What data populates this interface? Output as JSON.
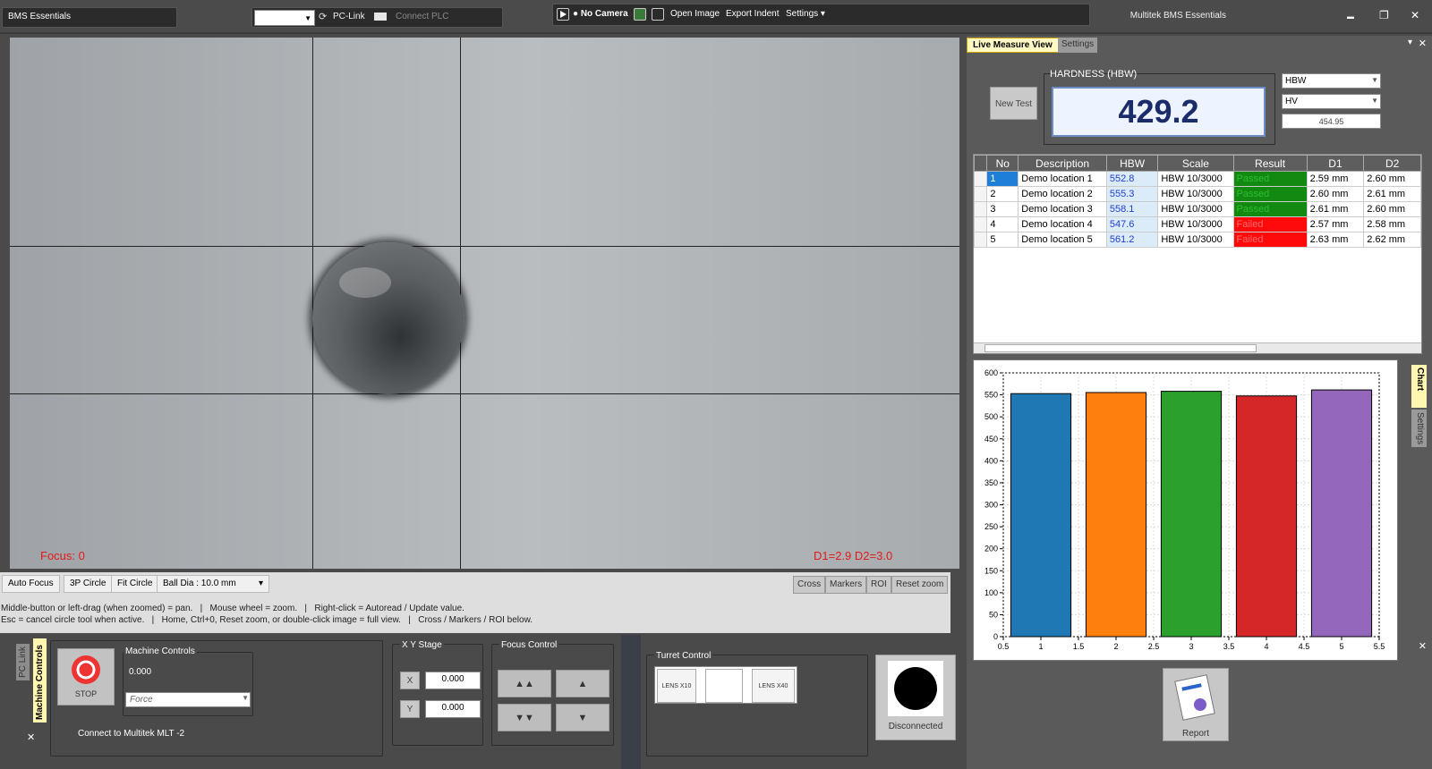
{
  "app": {
    "name": "BMS Essentials",
    "window_title": "Multitek BMS Essentials"
  },
  "plc": {
    "refresh_icon": "refresh-icon",
    "pclink_label": "PC-Link",
    "connect_label": "Connect PLC"
  },
  "toolbar": {
    "camera_status": "No Camera",
    "open_image": "Open Image",
    "export_indent": "Export Indent",
    "settings": "Settings"
  },
  "window_controls": {
    "minimize": "▬",
    "maximize": "❐",
    "close": "✕"
  },
  "camera": {
    "focus_label": "Focus: 0",
    "diameter_label": "D1=2.9 D2=3.0"
  },
  "tools": {
    "auto_focus": "Auto Focus",
    "circle_3p": "3P Circle",
    "fit_circle": "Fit Circle",
    "ball_dia": "Ball Dia : 10.0 mm",
    "cross": "Cross",
    "markers": "Markers",
    "roi": "ROI",
    "reset_zoom": "Reset zoom",
    "hint1": "Middle-button or left-drag (when zoomed) = pan.   |   Mouse wheel = zoom.   |   Right-click = Autoread / Update value.",
    "hint2": "Esc = cancel circle tool when active.   |   Home, Ctrl+0, Reset zoom, or double-click image = full view.   |   Cross / Markers / ROI below."
  },
  "machine": {
    "tab_pclink": "PC Link",
    "tab_machine": "Machine Controls",
    "stop_label": "STOP",
    "group_label": "Machine Controls",
    "value": "0.000",
    "force_placeholder": "Force",
    "connect_text": "Connect to Multitek MLT -2"
  },
  "xy_stage": {
    "label": "X Y Stage",
    "x_label": "X",
    "y_label": "Y",
    "x_value": "0.000",
    "y_value": "0.000"
  },
  "focus_control": {
    "label": "Focus Control",
    "up_fast": "▲▲",
    "up": "▲",
    "down_fast": "▼▼",
    "down": "▼"
  },
  "turret": {
    "label": "Turret Control",
    "lens1": "LENS X10",
    "lens2": "LENS X40"
  },
  "connection": {
    "status": "Disconnected"
  },
  "right_panel": {
    "tab_live": "Live Measure View",
    "tab_settings": "Settings",
    "hardness_label": "HARDNESS  (HBW)",
    "hardness_value": "429.2",
    "new_test": "New Test",
    "scale1": "HBW",
    "scale2": "HV",
    "converted_value": "454.95",
    "report": "Report",
    "chart_tab": "Chart",
    "chart_settings_tab": "Settings"
  },
  "table": {
    "headers": [
      "No",
      "Description",
      "HBW",
      "Scale",
      "Result",
      "D1",
      "D2"
    ],
    "rows": [
      [
        "1",
        "Demo location 1",
        "552.8",
        "HBW 10/3000",
        "Passed",
        "2.59 mm",
        "2.60 mm"
      ],
      [
        "2",
        "Demo location 2",
        "555.3",
        "HBW 10/3000",
        "Passed",
        "2.60 mm",
        "2.61 mm"
      ],
      [
        "3",
        "Demo location 3",
        "558.1",
        "HBW 10/3000",
        "Passed",
        "2.61 mm",
        "2.60 mm"
      ],
      [
        "4",
        "Demo location 4",
        "547.6",
        "HBW 10/3000",
        "Failed",
        "2.57 mm",
        "2.58 mm"
      ],
      [
        "5",
        "Demo location 5",
        "561.2",
        "HBW 10/3000",
        "Failed",
        "2.63 mm",
        "2.62 mm"
      ]
    ]
  },
  "chart_data": {
    "type": "bar",
    "x": [
      1,
      2,
      3,
      4,
      5
    ],
    "values": [
      552.8,
      555.3,
      558.1,
      547.6,
      561.2
    ],
    "colors": [
      "#1f77b4",
      "#ff7f0e",
      "#2ca02c",
      "#d62728",
      "#9467bd"
    ],
    "xlim": [
      0.5,
      5.5
    ],
    "ylim": [
      0,
      600
    ],
    "xticks": [
      "0.5",
      "1",
      "1.5",
      "2",
      "2.5",
      "3",
      "3.5",
      "4",
      "4.5",
      "5",
      "5.5"
    ],
    "yticks": [
      "0",
      "50",
      "100",
      "150",
      "200",
      "250",
      "300",
      "350",
      "400",
      "450",
      "500",
      "550",
      "600"
    ]
  }
}
